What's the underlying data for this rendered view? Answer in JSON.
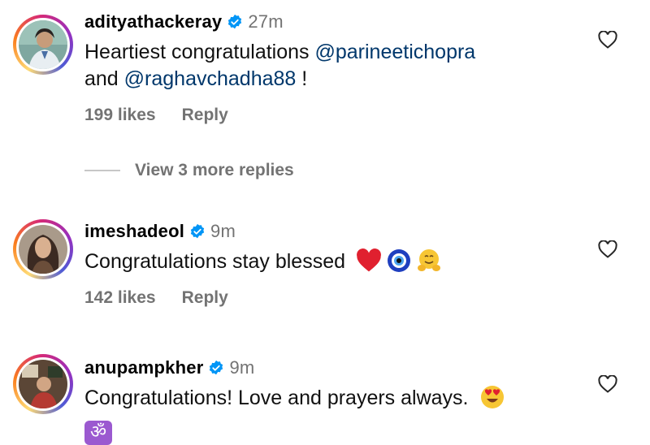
{
  "comments": [
    {
      "username": "adityathackeray",
      "time": "27m",
      "text_parts": [
        "Heartiest congratulations ",
        "@parineetichopra",
        "and ",
        "@raghavchadha88",
        " !"
      ],
      "likes": "199 likes",
      "reply": "Reply",
      "view_more": "View 3 more replies"
    },
    {
      "username": "imeshadeol",
      "time": "9m",
      "text": "Congratulations stay blessed",
      "emojis": [
        "red-heart",
        "nazar-amulet",
        "hugging-face"
      ],
      "likes": "142 likes",
      "reply": "Reply"
    },
    {
      "username": "anupampkher",
      "time": "9m",
      "text": "Congratulations! Love and prayers always.",
      "emojis": [
        "heart-eyes-face",
        "om-symbol"
      ],
      "om": "ॐ"
    }
  ],
  "colors": {
    "verified": "#0095f6",
    "mention": "#00376b",
    "secondary_text": "#737373"
  }
}
